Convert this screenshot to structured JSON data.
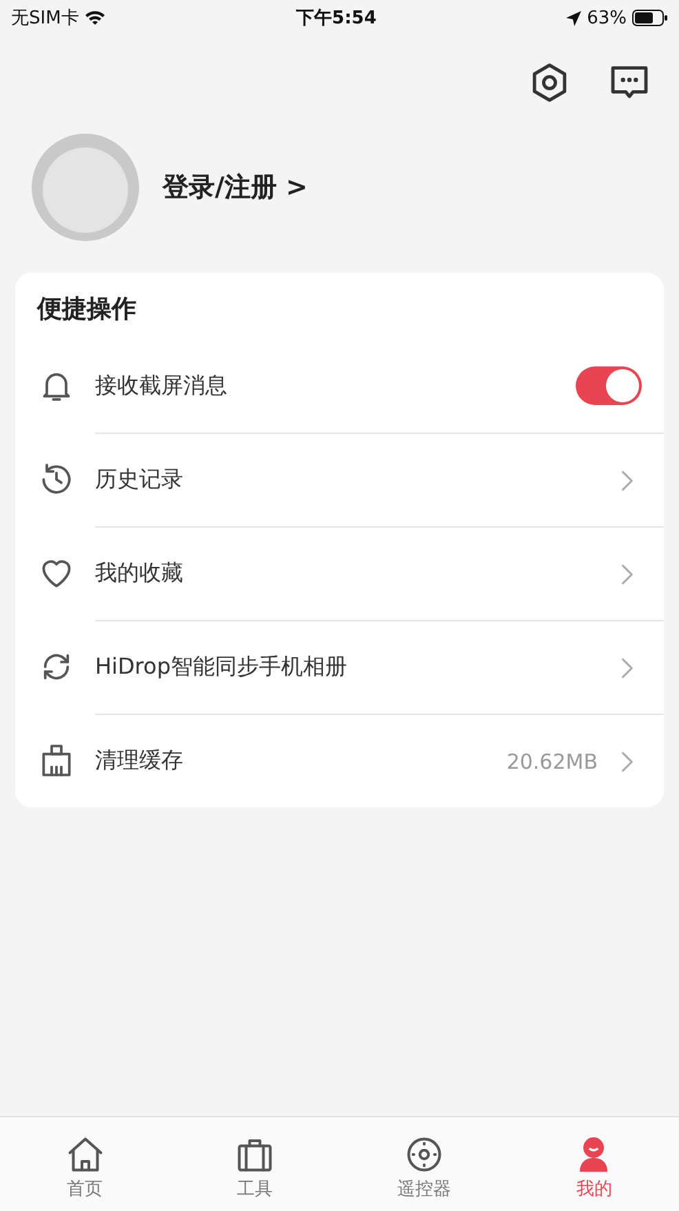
{
  "status_bar": {
    "carrier": "无SIM卡",
    "time": "下午5:54",
    "battery": "63%"
  },
  "profile": {
    "login": "登录/注册 >"
  },
  "quick_actions": {
    "title": "便捷操作",
    "items": [
      {
        "kind": "toggle",
        "label": "接收截屏消息",
        "on": true
      },
      {
        "kind": "link",
        "label": "历史记录"
      },
      {
        "kind": "link",
        "label": "我的收藏"
      },
      {
        "kind": "link",
        "label": "HiDrop智能同步手机相册"
      },
      {
        "kind": "link",
        "label": "清理缓存",
        "value": "20.62MB"
      }
    ]
  },
  "tab_bar": [
    {
      "label": "首页",
      "selected": false
    },
    {
      "label": "工具",
      "selected": false
    },
    {
      "label": "遥控器",
      "selected": false
    },
    {
      "label": "我的",
      "selected": true
    }
  ]
}
